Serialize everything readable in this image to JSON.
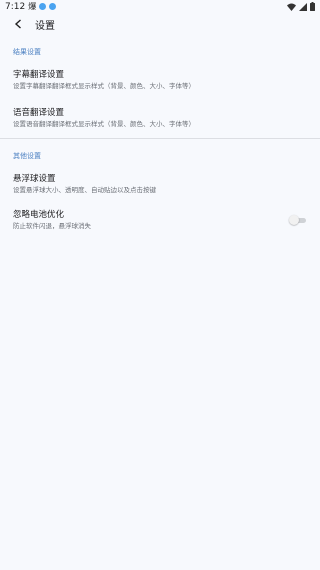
{
  "status_bar": {
    "time": "7:12",
    "app_icon": "爆",
    "notification_icons": [
      "notification-blue-icon",
      "notification-blue-icon"
    ],
    "indicator_color": "#4aa3f0",
    "right_icons": [
      "wifi-icon",
      "signal-icon",
      "battery-icon"
    ]
  },
  "app_bar": {
    "back_icon": "arrow-back-icon",
    "title": "设置"
  },
  "sections": [
    {
      "header": "结果设置",
      "items": [
        {
          "title": "字幕翻译设置",
          "subtitle": "设置字幕翻译翻译框式显示样式（背景、颜色、大小、字体等）"
        },
        {
          "title": "语音翻译设置",
          "subtitle": "设置语音翻译翻译框式显示样式（背景、颜色、大小、字体等）"
        }
      ]
    },
    {
      "header": "其他设置",
      "items": [
        {
          "title": "悬浮球设置",
          "subtitle": "设置悬浮球大小、透明度、自动贴边以及点击按键"
        },
        {
          "title": "忽略电池优化",
          "subtitle": "防止软件闪退，悬浮球消失",
          "toggle": {
            "on": false
          }
        }
      ]
    }
  ],
  "colors": {
    "background": "#f7f9fd",
    "section_header": "#4a7fc1",
    "divider": "#dcdee3"
  }
}
